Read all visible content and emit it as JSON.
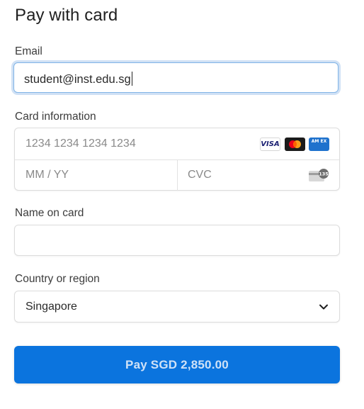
{
  "header": {
    "title": "Pay with card"
  },
  "form": {
    "email": {
      "label": "Email",
      "value": "student@inst.edu.sg"
    },
    "card": {
      "label": "Card information",
      "number_placeholder": "1234 1234 1234 1234",
      "expiry_placeholder": "MM / YY",
      "cvc_placeholder": "CVC",
      "brands": [
        "visa-icon",
        "mastercard-icon",
        "amex-icon"
      ],
      "visa_text": "VISA",
      "amex_text": "AM EX",
      "cvc_icon_text": "135"
    },
    "name": {
      "label": "Name on card",
      "value": ""
    },
    "country": {
      "label": "Country or region",
      "value": "Singapore"
    }
  },
  "action": {
    "pay_label": "Pay SGD 2,850.00",
    "color": "#0b74de"
  },
  "colors": {
    "focus_ring": "#7fb3e6",
    "button": "#0b74de",
    "button_text": "#cfe2f7"
  }
}
